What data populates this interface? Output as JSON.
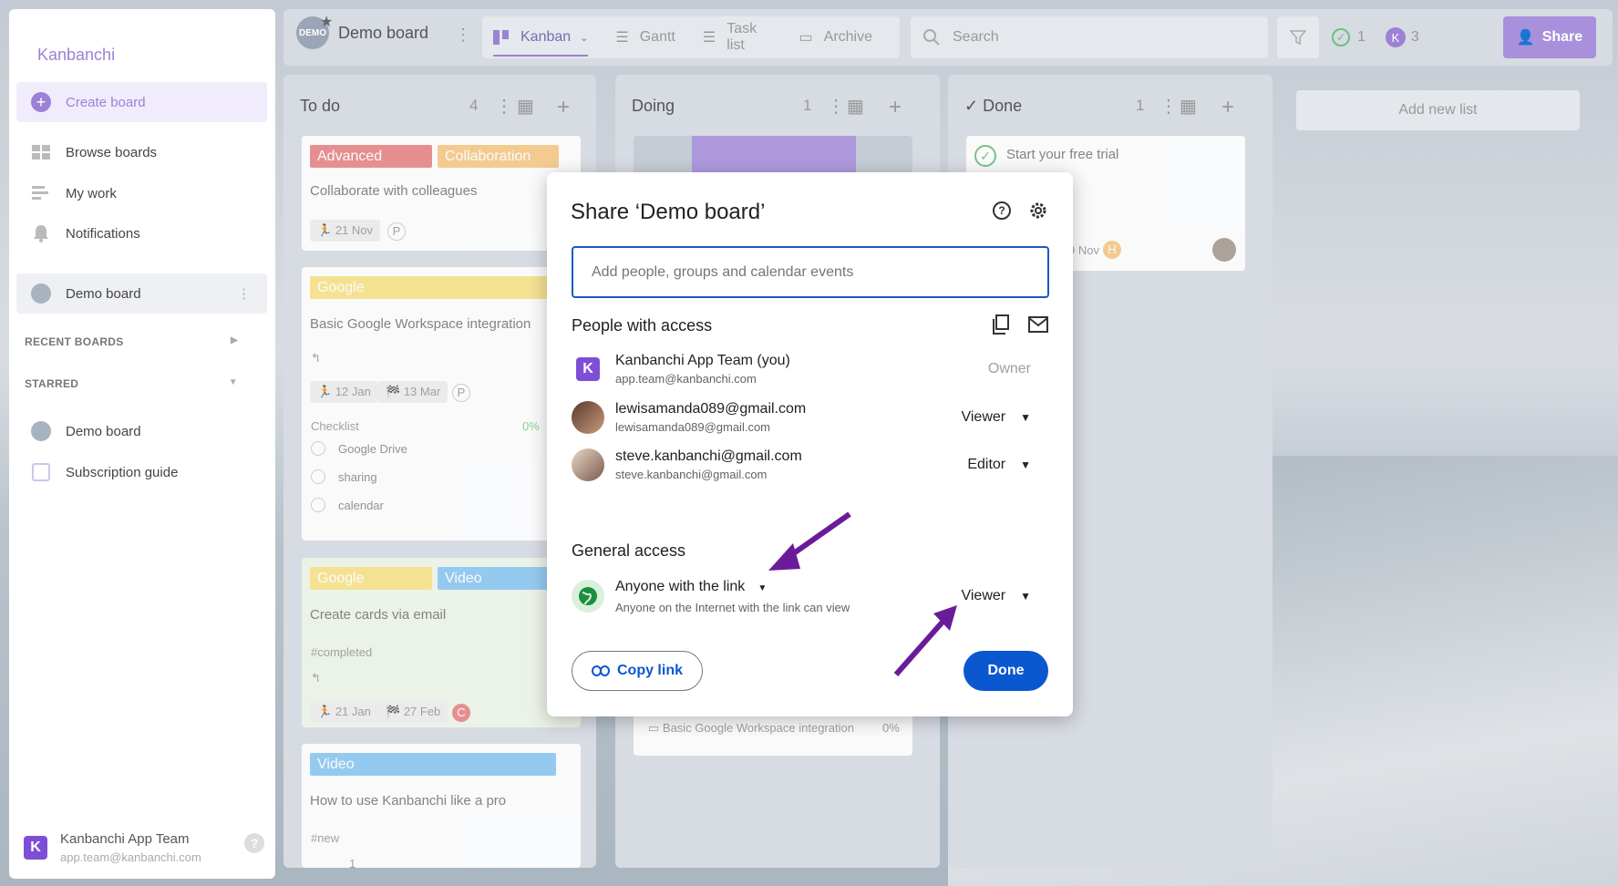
{
  "app": {
    "logo": "Kanbanchi"
  },
  "sidebar": {
    "create": "Create board",
    "items": [
      {
        "label": "Browse boards"
      },
      {
        "label": "My work"
      },
      {
        "label": "Notifications"
      }
    ],
    "current_board": "Demo board",
    "recent_title": "RECENT BOARDS",
    "starred_title": "STARRED",
    "starred": [
      {
        "label": "Demo board"
      },
      {
        "label": "Subscription guide"
      }
    ],
    "user": {
      "initial": "K",
      "name": "Kanbanchi App Team",
      "email": "app.team@kanbanchi.com"
    }
  },
  "topbar": {
    "board_title": "Demo board",
    "board_badge": "DEMO",
    "tabs": [
      {
        "label": "Kanban"
      },
      {
        "label": "Gantt"
      },
      {
        "label": "Task list"
      },
      {
        "label": "Archive"
      }
    ],
    "search_placeholder": "Search",
    "done_count": "1",
    "k_initial": "K",
    "k_count": "3",
    "share": "Share"
  },
  "lists": [
    {
      "title": "To do",
      "count": "4"
    },
    {
      "title": "Doing",
      "count": "1"
    },
    {
      "title": "Done",
      "count": "1"
    }
  ],
  "add_list": "Add new list",
  "todo_cards": {
    "c1": {
      "tags": [
        "Advanced",
        "Collaboration"
      ],
      "title": "Collaborate with colleagues",
      "date": "21 Nov",
      "badge": "P"
    },
    "c2": {
      "tag": "Google",
      "title": "Basic Google Workspace integration",
      "start": "12 Jan",
      "due": "13 Mar",
      "badge": "P",
      "checklist": "Checklist",
      "percent": "0%",
      "items": [
        "Google Drive",
        "sharing",
        "calendar"
      ]
    },
    "c3": {
      "tags": [
        "Google",
        "Video"
      ],
      "title": "Create cards via email",
      "hashtag": "#completed",
      "start": "21 Jan",
      "due": "27 Feb",
      "badge": "C"
    },
    "c4": {
      "tag": "Video",
      "title": "How to use Kanbanchi like a pro",
      "hashtag": "#new",
      "meta": "1"
    }
  },
  "doing_card": {
    "sub": "Basic Google Workspace integration",
    "percent": "0%"
  },
  "done_card": {
    "title": "Start your free trial",
    "date": "9 Nov",
    "badge": "H"
  },
  "dialog": {
    "title": "Share ‘Demo board’",
    "input_placeholder": "Add people, groups and calendar events",
    "people_title": "People with access",
    "people": [
      {
        "name": "Kanbanchi App Team (you)",
        "email": "app.team@kanbanchi.com",
        "role": "Owner",
        "initial": "K"
      },
      {
        "name": "lewisamanda089@gmail.com",
        "email": "lewisamanda089@gmail.com",
        "role": "Viewer"
      },
      {
        "name": "steve.kanbanchi@gmail.com",
        "email": "steve.kanbanchi@gmail.com",
        "role": "Editor"
      }
    ],
    "general_title": "General access",
    "general": {
      "name": "Anyone with the link",
      "desc": "Anyone on the Internet with the link can view",
      "role": "Viewer"
    },
    "copy_link": "Copy link",
    "done": "Done"
  },
  "colors": {
    "accent": "#9b82d6",
    "google_blue": "#0b57d0",
    "annotation_arrow": "#6a1b9a"
  }
}
